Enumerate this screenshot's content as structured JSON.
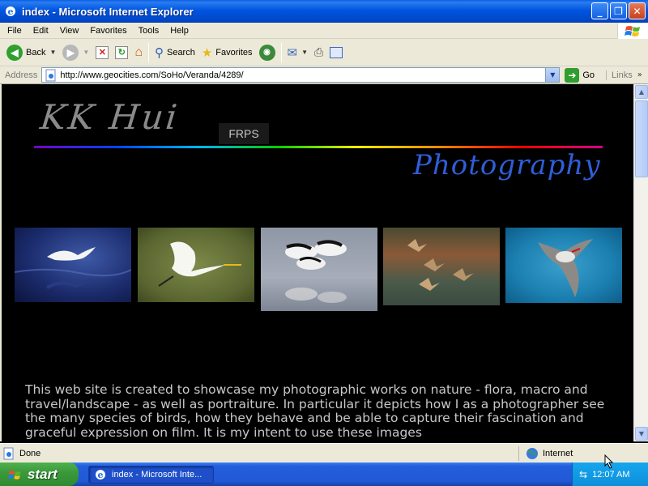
{
  "window": {
    "title": "index - Microsoft Internet Explorer",
    "minimize": "_",
    "maximize": "❐",
    "close": "✕"
  },
  "menu": [
    "File",
    "Edit",
    "View",
    "Favorites",
    "Tools",
    "Help"
  ],
  "toolbar": {
    "back_label": "Back",
    "search_label": "Search",
    "favorites_label": "Favorites"
  },
  "address": {
    "label": "Address",
    "url": "http://www.geocities.com/SoHo/Veranda/4289/",
    "go_label": "Go",
    "links_label": "Links"
  },
  "page": {
    "logo_name": "KK Hui",
    "badge": "FRPS",
    "subtitle": "Photography",
    "intro_text": "This web site is created to showcase my photographic works on nature - flora, macro and travel/landscape - as well as portraiture. In particular it depicts how I as a photographer see the many species of birds, how they behave and be able to capture their fascination and graceful expression on film. It is my intent to use these images"
  },
  "status": {
    "text": "Done",
    "zone": "Internet"
  },
  "taskbar": {
    "start_label": "start",
    "task_label": "index - Microsoft Inte...",
    "clock": "12:07 AM"
  },
  "colors": {
    "titlebar": "#0055e0",
    "page_bg": "#000000",
    "logo_gray": "#8a8a8a",
    "photography_blue": "#2f5ed8",
    "body_text": "#c8c8c8"
  }
}
